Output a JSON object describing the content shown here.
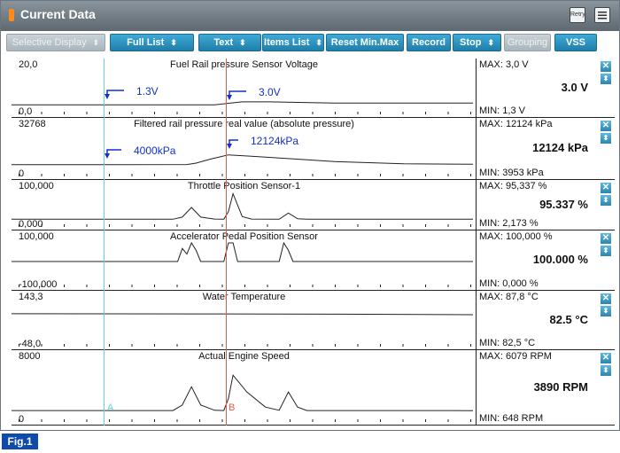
{
  "window": {
    "title": "Current Data",
    "retry_label": "Retry"
  },
  "toolbar": {
    "buttons": [
      {
        "label": "Selective Display",
        "arrows": "⬍",
        "disabled": true
      },
      {
        "label": "Full List",
        "arrows": "⬍",
        "disabled": false
      },
      {
        "label": "Text",
        "arrows": "⬍",
        "disabled": false
      },
      {
        "label": "Items List",
        "arrows": "⬍",
        "disabled": false
      },
      {
        "label": "Reset Min.Max",
        "arrows": "",
        "disabled": false
      },
      {
        "label": "Record",
        "arrows": "",
        "disabled": false
      },
      {
        "label": "Stop",
        "arrows": "⬍",
        "disabled": false
      },
      {
        "label": "Grouping",
        "arrows": "",
        "disabled": true
      },
      {
        "label": "VSS",
        "arrows": "",
        "disabled": false
      }
    ]
  },
  "panels": [
    {
      "title": "Fuel Rail pressure Sensor Voltage",
      "scale_max": "20,0",
      "scale_min": "0,0",
      "max": "MAX:   3,0 V",
      "min": "MIN:   1,3 V",
      "current": "3.0 V",
      "annotations": [
        {
          "text": "1.3V"
        },
        {
          "text": "3.0V"
        }
      ],
      "trace": [
        [
          0,
          1.3
        ],
        [
          0.22,
          1.3
        ],
        [
          0.44,
          1.3
        ],
        [
          0.47,
          2.2
        ],
        [
          0.5,
          3.0
        ],
        [
          0.56,
          3.0
        ],
        [
          0.62,
          2.7
        ],
        [
          0.7,
          2.3
        ],
        [
          1.0,
          2.3
        ]
      ],
      "range": [
        0,
        20
      ]
    },
    {
      "title": "Filtered rail pressure real value (absolute pressure)",
      "scale_max": "32768",
      "scale_min": "0",
      "max": "MAX: 12124 kPa",
      "min": "MIN:  3953 kPa",
      "current": "12124 kPa",
      "annotations": [
        {
          "text": "4000kPa"
        },
        {
          "text": "12124kPa"
        }
      ],
      "trace": [
        [
          0,
          3953
        ],
        [
          0.2,
          3960
        ],
        [
          0.38,
          4000
        ],
        [
          0.4,
          5200
        ],
        [
          0.43,
          8500
        ],
        [
          0.47,
          12124
        ],
        [
          0.52,
          11000
        ],
        [
          0.6,
          9000
        ],
        [
          0.7,
          6500
        ],
        [
          0.85,
          4600
        ],
        [
          1.0,
          4300
        ]
      ],
      "range": [
        0,
        32768
      ]
    },
    {
      "title": "Throttle Position Sensor-1",
      "scale_max": "100,000",
      "scale_min": "0,000",
      "max": "MAX: 95,337 %",
      "min": "MIN: 2,173 %",
      "current": "95.337 %",
      "trace": [
        [
          0,
          2.2
        ],
        [
          0.35,
          2.2
        ],
        [
          0.37,
          10
        ],
        [
          0.39,
          45
        ],
        [
          0.41,
          10
        ],
        [
          0.44,
          3
        ],
        [
          0.46,
          2.2
        ],
        [
          0.47,
          30
        ],
        [
          0.48,
          95.3
        ],
        [
          0.5,
          12
        ],
        [
          0.52,
          3
        ],
        [
          0.58,
          2.2
        ],
        [
          0.6,
          25
        ],
        [
          0.62,
          4
        ],
        [
          0.64,
          2.2
        ],
        [
          1.0,
          2.2
        ]
      ],
      "range": [
        0,
        100
      ]
    },
    {
      "title": "Accelerator Pedal Position Sensor",
      "scale_max": "100,000",
      "scale_min": "-100,000",
      "max": "MAX: 100,000 %",
      "min": "MIN: 0,000 %",
      "current": "100.000 %",
      "trace": [
        [
          0,
          0
        ],
        [
          0.36,
          0
        ],
        [
          0.37,
          70
        ],
        [
          0.38,
          40
        ],
        [
          0.39,
          100
        ],
        [
          0.4,
          60
        ],
        [
          0.41,
          0
        ],
        [
          0.46,
          0
        ],
        [
          0.47,
          100
        ],
        [
          0.48,
          100
        ],
        [
          0.49,
          0
        ],
        [
          0.58,
          0
        ],
        [
          0.59,
          100
        ],
        [
          0.6,
          60
        ],
        [
          0.61,
          0
        ],
        [
          1.0,
          0
        ]
      ],
      "range": [
        -100,
        100
      ]
    },
    {
      "title": "Water Temperature",
      "scale_max": "143,3",
      "scale_min": "-48,0",
      "max": "MAX:  87,8 °C",
      "min": "MIN:  82,5 °C",
      "current": "82.5 °C",
      "trace": [
        [
          0,
          87.8
        ],
        [
          0.4,
          87.0
        ],
        [
          0.7,
          85.5
        ],
        [
          1.0,
          82.5
        ]
      ],
      "range": [
        -48,
        143.3
      ]
    },
    {
      "title": "Actual Engine Speed",
      "scale_max": "8000",
      "scale_min": "0",
      "max": "MAX:   6079 RPM",
      "min": "MIN:   648 RPM",
      "current": "3890 RPM",
      "trace": [
        [
          0,
          660
        ],
        [
          0.35,
          660
        ],
        [
          0.37,
          1500
        ],
        [
          0.39,
          4300
        ],
        [
          0.41,
          1500
        ],
        [
          0.44,
          700
        ],
        [
          0.46,
          660
        ],
        [
          0.47,
          2500
        ],
        [
          0.48,
          6079
        ],
        [
          0.51,
          3500
        ],
        [
          0.55,
          1200
        ],
        [
          0.58,
          700
        ],
        [
          0.6,
          3500
        ],
        [
          0.62,
          1200
        ],
        [
          0.64,
          660
        ],
        [
          1.0,
          650
        ]
      ],
      "range": [
        0,
        8000
      ]
    }
  ],
  "cursors": {
    "a_label": "A",
    "b_label": "B"
  },
  "figure_label": "Fig.1",
  "colors": {
    "accent": "#2a8fbd",
    "cursor_a": "#60d8e0",
    "cursor_b": "#e85a40",
    "annotation": "#1030c8",
    "fig_label": "#0f4ba8"
  }
}
